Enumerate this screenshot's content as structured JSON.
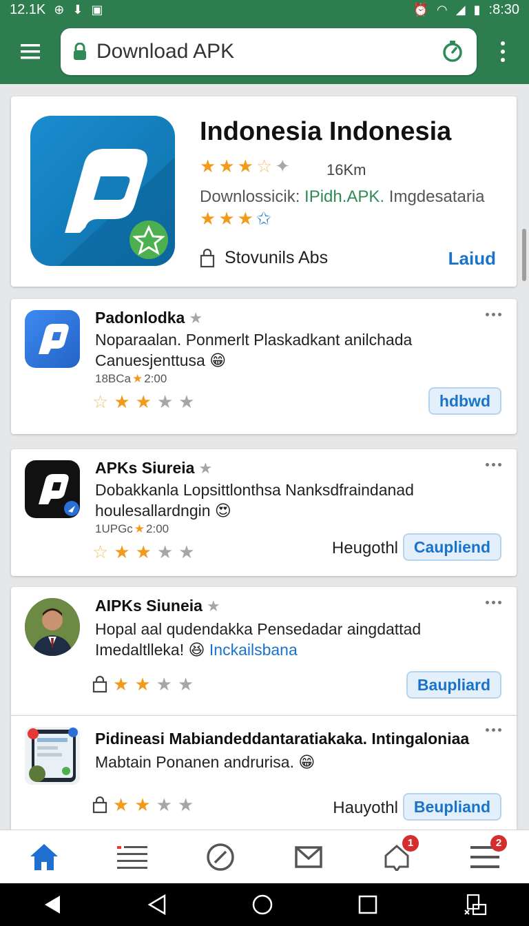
{
  "status_bar": {
    "left_text": "12.1K",
    "time": ":8:30"
  },
  "toolbar": {
    "url_text": "Download APK"
  },
  "hero": {
    "title": "Indonesia Indonesia",
    "rating": 3.5,
    "size": "16Km",
    "download_prefix": "Downlossicik: ",
    "download_link": "IPidh.APK.",
    "download_suffix": " Imgdesataria",
    "secondary_stars": 3,
    "footer_label": "Stovunils Abs",
    "action_link": "Laiud"
  },
  "items": [
    {
      "title": "Padonlodka",
      "desc_line1": "Noparaalan. Ponmerlt  Plaskadkant anilchada",
      "desc_line2": "Canuesjenttusa",
      "meta_prefix": "18BCa",
      "meta_time": "2:00",
      "rating": 2.5,
      "side_text": "",
      "button": "hdbwd"
    },
    {
      "title": "APKs Siureia",
      "desc_line1": "Dobakkanla  Lopsittlonthsa Nanksdfraindanad",
      "desc_line2": "houlesallardngin",
      "meta_prefix": "1UPGc",
      "meta_time": "2:00",
      "rating": 2.5,
      "side_text": "Heugothl",
      "button": "Caupliend"
    },
    {
      "title": "AIPKs Siuneia",
      "desc_line1": "Hopal aal qudendakka Pensedadar aingdattad",
      "desc_line2": "Imedaltlleka!",
      "desc_link": "Inckailsbana",
      "rating": 2,
      "side_text": "",
      "button": "Baupliard"
    },
    {
      "title": "Pidineasi Mabiandeddantaratiakaka. Intingaloniaa",
      "desc_line1": "Mabtain Ponanen andrurisa.",
      "rating": 2,
      "side_text": "Hauyothl",
      "button": "Beupliand"
    }
  ],
  "bottom_nav": {
    "badge_alerts": "1",
    "badge_menu": "2"
  },
  "colors": {
    "brand_green": "#2e7d4f",
    "accent_blue": "#1a73c9",
    "star_orange": "#f29a1b"
  }
}
